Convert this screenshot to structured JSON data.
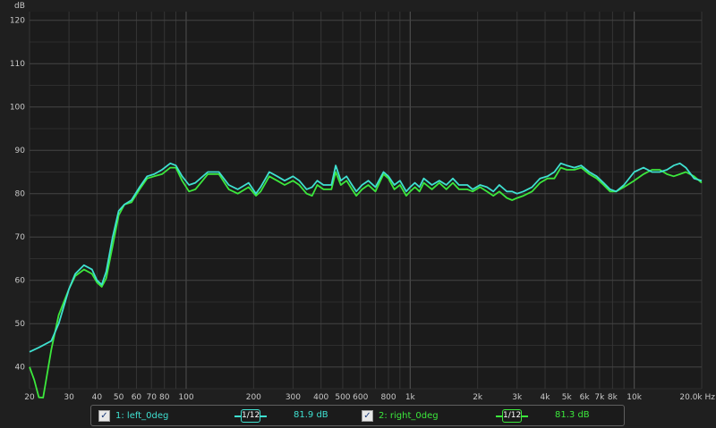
{
  "chart_data": {
    "type": "line",
    "y_unit_label": "dB",
    "ylim": [
      35,
      122
    ],
    "xlim": [
      20,
      20000
    ],
    "x_scale": "log",
    "grid": true,
    "y_ticks": [
      40,
      50,
      60,
      70,
      80,
      90,
      100,
      110,
      120
    ],
    "x_ticks": [
      {
        "v": 20,
        "l": "20"
      },
      {
        "v": 30,
        "l": "30"
      },
      {
        "v": 40,
        "l": "40"
      },
      {
        "v": 50,
        "l": "50"
      },
      {
        "v": 60,
        "l": "60"
      },
      {
        "v": 70,
        "l": "70"
      },
      {
        "v": 80,
        "l": "80"
      },
      {
        "v": 100,
        "l": "100"
      },
      {
        "v": 200,
        "l": "200"
      },
      {
        "v": 300,
        "l": "300"
      },
      {
        "v": 400,
        "l": "400"
      },
      {
        "v": 500,
        "l": "500"
      },
      {
        "v": 600,
        "l": "600"
      },
      {
        "v": 800,
        "l": "800"
      },
      {
        "v": 1000,
        "l": "1k"
      },
      {
        "v": 2000,
        "l": "2k"
      },
      {
        "v": 3000,
        "l": "3k"
      },
      {
        "v": 4000,
        "l": "4k"
      },
      {
        "v": 5000,
        "l": "5k"
      },
      {
        "v": 6000,
        "l": "6k"
      },
      {
        "v": 7000,
        "l": "7k"
      },
      {
        "v": 8000,
        "l": "8k"
      },
      {
        "v": 10000,
        "l": "10k"
      },
      {
        "v": 20000,
        "l": "20.0k Hz"
      }
    ],
    "series": [
      {
        "name": "1: left_0deg",
        "color": "#3fe0d0",
        "points": [
          [
            20,
            43.5
          ],
          [
            22,
            44.5
          ],
          [
            25,
            46
          ],
          [
            27,
            50
          ],
          [
            30,
            58
          ],
          [
            32,
            61.5
          ],
          [
            35,
            63.5
          ],
          [
            38,
            62.5
          ],
          [
            40,
            60
          ],
          [
            42,
            59
          ],
          [
            44,
            62
          ],
          [
            47,
            70
          ],
          [
            50,
            76
          ],
          [
            53,
            77.5
          ],
          [
            57,
            78.5
          ],
          [
            62,
            81.5
          ],
          [
            67,
            84
          ],
          [
            72,
            84.5
          ],
          [
            78,
            85.5
          ],
          [
            85,
            87
          ],
          [
            90,
            86.5
          ],
          [
            96,
            84
          ],
          [
            103,
            82
          ],
          [
            110,
            82.5
          ],
          [
            125,
            85
          ],
          [
            140,
            85
          ],
          [
            155,
            82
          ],
          [
            170,
            81
          ],
          [
            190,
            82.5
          ],
          [
            205,
            80
          ],
          [
            215,
            81.5
          ],
          [
            235,
            85
          ],
          [
            255,
            84
          ],
          [
            275,
            83
          ],
          [
            300,
            84
          ],
          [
            320,
            83
          ],
          [
            345,
            81
          ],
          [
            365,
            81.5
          ],
          [
            385,
            83
          ],
          [
            410,
            82
          ],
          [
            445,
            82
          ],
          [
            465,
            86.5
          ],
          [
            490,
            83
          ],
          [
            520,
            84
          ],
          [
            550,
            82
          ],
          [
            575,
            80.5
          ],
          [
            610,
            82
          ],
          [
            650,
            83
          ],
          [
            700,
            81.5
          ],
          [
            760,
            85
          ],
          [
            800,
            84
          ],
          [
            850,
            82
          ],
          [
            900,
            83
          ],
          [
            960,
            80.5
          ],
          [
            1000,
            81.5
          ],
          [
            1050,
            82.5
          ],
          [
            1100,
            81.5
          ],
          [
            1150,
            83.5
          ],
          [
            1250,
            82
          ],
          [
            1350,
            83
          ],
          [
            1450,
            82
          ],
          [
            1550,
            83.5
          ],
          [
            1650,
            82
          ],
          [
            1800,
            82
          ],
          [
            1900,
            81
          ],
          [
            2050,
            82
          ],
          [
            2200,
            81.5
          ],
          [
            2350,
            80.5
          ],
          [
            2500,
            82
          ],
          [
            2700,
            80.5
          ],
          [
            2850,
            80.5
          ],
          [
            3000,
            80
          ],
          [
            3200,
            80.5
          ],
          [
            3500,
            81.5
          ],
          [
            3800,
            83.5
          ],
          [
            4100,
            84
          ],
          [
            4400,
            85
          ],
          [
            4700,
            87
          ],
          [
            5000,
            86.5
          ],
          [
            5400,
            86
          ],
          [
            5800,
            86.5
          ],
          [
            6300,
            85
          ],
          [
            6800,
            84
          ],
          [
            7300,
            82.5
          ],
          [
            7800,
            81
          ],
          [
            8300,
            80.5
          ],
          [
            9000,
            82
          ],
          [
            10000,
            85
          ],
          [
            11000,
            86
          ],
          [
            12000,
            85
          ],
          [
            13000,
            85
          ],
          [
            14000,
            85.5
          ],
          [
            15000,
            86.5
          ],
          [
            16000,
            87
          ],
          [
            17000,
            86
          ],
          [
            18500,
            83.5
          ],
          [
            20000,
            83
          ]
        ]
      },
      {
        "name": "2: right_0deg",
        "color": "#3ce83c",
        "points": [
          [
            20,
            40
          ],
          [
            21,
            37
          ],
          [
            22,
            33
          ],
          [
            23,
            30
          ],
          [
            25,
            44
          ],
          [
            27,
            52
          ],
          [
            30,
            58
          ],
          [
            32,
            61
          ],
          [
            35,
            62.5
          ],
          [
            38,
            61.5
          ],
          [
            40,
            59.5
          ],
          [
            42,
            58.5
          ],
          [
            44,
            60.5
          ],
          [
            47,
            68
          ],
          [
            50,
            75
          ],
          [
            53,
            77.5
          ],
          [
            57,
            78
          ],
          [
            62,
            81
          ],
          [
            67,
            83.5
          ],
          [
            72,
            84
          ],
          [
            78,
            84.5
          ],
          [
            85,
            86
          ],
          [
            90,
            86
          ],
          [
            96,
            83
          ],
          [
            103,
            80.5
          ],
          [
            110,
            81
          ],
          [
            125,
            84.5
          ],
          [
            140,
            84.5
          ],
          [
            155,
            81
          ],
          [
            170,
            80
          ],
          [
            190,
            81.5
          ],
          [
            205,
            79.5
          ],
          [
            215,
            80.5
          ],
          [
            235,
            84
          ],
          [
            255,
            83
          ],
          [
            275,
            82
          ],
          [
            300,
            83
          ],
          [
            320,
            82
          ],
          [
            345,
            80
          ],
          [
            365,
            79.5
          ],
          [
            385,
            82
          ],
          [
            410,
            81
          ],
          [
            445,
            81
          ],
          [
            465,
            85
          ],
          [
            490,
            82
          ],
          [
            520,
            83
          ],
          [
            550,
            81
          ],
          [
            575,
            79.5
          ],
          [
            610,
            81
          ],
          [
            650,
            82
          ],
          [
            700,
            80.5
          ],
          [
            760,
            84.5
          ],
          [
            800,
            83.5
          ],
          [
            850,
            81
          ],
          [
            900,
            82
          ],
          [
            960,
            79.5
          ],
          [
            1000,
            80.5
          ],
          [
            1050,
            81.5
          ],
          [
            1100,
            80.5
          ],
          [
            1150,
            82.5
          ],
          [
            1250,
            81
          ],
          [
            1350,
            82.5
          ],
          [
            1450,
            81
          ],
          [
            1550,
            82.5
          ],
          [
            1650,
            81
          ],
          [
            1800,
            81
          ],
          [
            1900,
            80.5
          ],
          [
            2050,
            81.5
          ],
          [
            2200,
            80.5
          ],
          [
            2350,
            79.5
          ],
          [
            2500,
            80.5
          ],
          [
            2700,
            79
          ],
          [
            2850,
            78.5
          ],
          [
            3000,
            79
          ],
          [
            3200,
            79.5
          ],
          [
            3500,
            80.5
          ],
          [
            3800,
            82.5
          ],
          [
            4100,
            83.5
          ],
          [
            4400,
            83.5
          ],
          [
            4700,
            86
          ],
          [
            5000,
            85.5
          ],
          [
            5400,
            85.5
          ],
          [
            5800,
            86
          ],
          [
            6300,
            84.5
          ],
          [
            6800,
            83.5
          ],
          [
            7300,
            82
          ],
          [
            7800,
            80.5
          ],
          [
            8300,
            80.5
          ],
          [
            9000,
            81.5
          ],
          [
            10000,
            83
          ],
          [
            11000,
            84.5
          ],
          [
            12000,
            85.5
          ],
          [
            13000,
            85.5
          ],
          [
            14000,
            84.5
          ],
          [
            15000,
            84
          ],
          [
            16000,
            84.5
          ],
          [
            17000,
            85
          ],
          [
            18500,
            84
          ],
          [
            20000,
            82.5
          ]
        ]
      }
    ]
  },
  "legend": {
    "items": [
      {
        "label": "1: left_0deg",
        "checked": "✓",
        "smoothing": "1/12",
        "value": "81.9 dB",
        "color": "#3fe0d0"
      },
      {
        "label": "2: right_0deg",
        "checked": "✓",
        "smoothing": "1/12",
        "value": "81.3 dB",
        "color": "#3ce83c"
      }
    ]
  }
}
